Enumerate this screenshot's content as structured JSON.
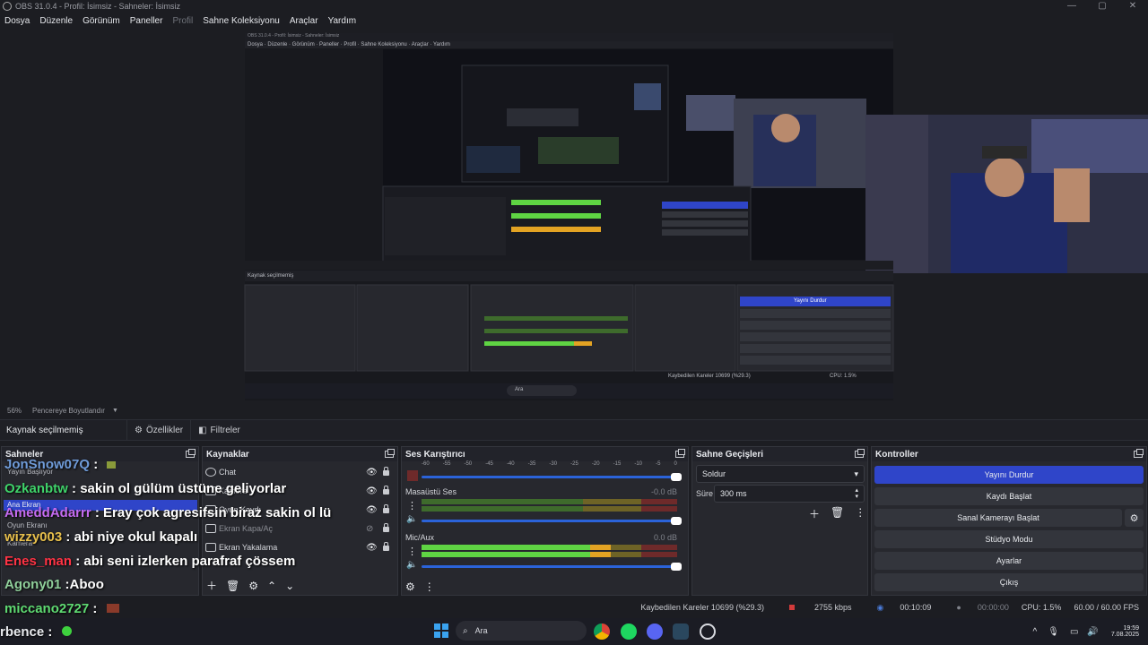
{
  "window": {
    "title": "OBS 31.0.4 - Profil: İsimsiz - Sahneler: İsimsiz"
  },
  "menu": [
    "Dosya",
    "Düzenle",
    "Görünüm",
    "Paneller",
    "Profil",
    "Sahne Koleksiyonu",
    "Araçlar",
    "Yardım"
  ],
  "preview": {
    "zoom": "56%",
    "fit_label": "Pencereye Boyutlandır"
  },
  "source_bar": {
    "no_source": "Kaynak seçilmemiş",
    "properties": "Özellikler",
    "filters": "Filtreler"
  },
  "panels": {
    "scenes": "Sahneler",
    "sources": "Kaynaklar",
    "mixer": "Ses Karıştırıcı",
    "transitions": "Sahne Geçişleri",
    "controls": "Kontroller"
  },
  "chat": [
    {
      "user": "JonSnow07Q",
      "sep": " :",
      "msg": "",
      "color": "#6f9bd8"
    },
    {
      "user": "Ozkanbtw",
      "sep": " : ",
      "msg": "sakin ol gülüm üstüne geliyorlar",
      "color": "#3fd36a"
    },
    {
      "user": "AmeddAdarrr",
      "sep": " : ",
      "msg": "Eray çok agresifsin biraz sakin ol lü",
      "color": "#c46bf0"
    },
    {
      "user": "wizzy003",
      "sep": " : ",
      "msg": "abi niye okul kapalı",
      "color": "#e8c04c"
    },
    {
      "user": "Enes_man",
      "sep": " : ",
      "msg": "abi seni izlerken parafraf çössem",
      "color": "#ff3344"
    },
    {
      "user": "Agony01",
      "sep": " :",
      "msg": "Aboo",
      "color": "#8fcf9a"
    },
    {
      "user": "miccano2727",
      "sep": " :",
      "msg": "",
      "color": "#5fdb72"
    },
    {
      "user": "rbence",
      "sep": " :",
      "msg": "",
      "color": "#e8eaee"
    }
  ],
  "scene_labels": {
    "scene1": "Yayın Başlıyor",
    "scene_active": "Ana Ekran",
    "scene3": "Oyun Ekranı",
    "scene4": "Kamera"
  },
  "sources": [
    {
      "name": "Chat"
    },
    {
      "name": "Kamera"
    },
    {
      "name": "Oyun Kaydı"
    },
    {
      "name": "Ekran Kapa/Aç"
    },
    {
      "name": "Ekran Yakalama"
    }
  ],
  "mixer": {
    "scale": [
      "-60",
      "-55",
      "-50",
      "-45",
      "-40",
      "-35",
      "-30",
      "-25",
      "-20",
      "-15",
      "-10",
      "-5",
      "0"
    ],
    "channels": [
      {
        "name": "",
        "db": "",
        "level": 0.0
      },
      {
        "name": "Masaüstü Ses",
        "db": "-0.0 dB",
        "level": 0.0
      },
      {
        "name": "Mic/Aux",
        "db": "0.0 dB",
        "level": 0.74
      }
    ]
  },
  "transitions": {
    "type": "Soldur",
    "duration_label": "Süre",
    "duration": "300 ms"
  },
  "controls": {
    "stop_stream": "Yayını Durdur",
    "start_record": "Kaydı Başlat",
    "virtual_cam": "Sanal Kamerayı Başlat",
    "studio_mode": "Stüdyo Modu",
    "settings": "Ayarlar",
    "exit": "Çıkış"
  },
  "status": {
    "dropped": "Kaybedilen Kareler 10699 (%29.3)",
    "bitrate": "2755 kbps",
    "stream_time": "00:10:09",
    "rec_time": "00:00:00",
    "cpu": "CPU: 1.5%",
    "fps": "60.00 / 60.00 FPS"
  },
  "taskbar": {
    "search": "Ara",
    "time": "19:59",
    "date": "7.08.2025"
  },
  "colors": {
    "accent": "#2f45c9",
    "slider": "#2b63d9",
    "meter_green": "#5fd443",
    "meter_yellow": "#e3a323"
  }
}
